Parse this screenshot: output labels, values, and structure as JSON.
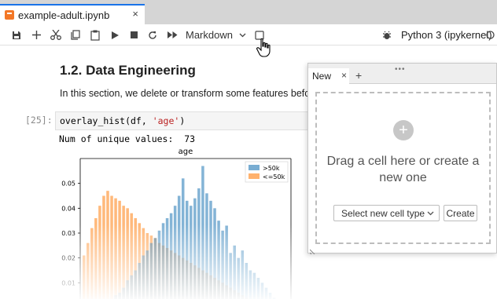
{
  "tab": {
    "title": "example-adult.ipynb",
    "close": "×"
  },
  "toolbar": {
    "cell_type": "Markdown",
    "kernel": "Python 3 (ipykernel)"
  },
  "notebook": {
    "heading": "1.2. Data Engineering",
    "paragraph": "In this section, we delete or transform some features before",
    "prompt": "[25]:",
    "code_fn": "overlay_hist(df, ",
    "code_str": "'age'",
    "code_end": ")",
    "output": "Num of unique values:  73"
  },
  "chart_data": {
    "type": "bar",
    "title": "age",
    "yticks": [
      "0.05",
      "0.04",
      "0.03",
      "0.02",
      "0.01"
    ],
    "ylim": [
      0,
      0.06
    ],
    "legend": [
      "<=50k",
      ">50k"
    ],
    "legend_position": "top-right",
    "series": [
      {
        "name": ">50k",
        "color": "#1f77b4",
        "values": [
          0.0,
          0.0,
          0.0,
          0.0,
          0.0,
          0.001,
          0.002,
          0.003,
          0.005,
          0.006,
          0.008,
          0.011,
          0.013,
          0.015,
          0.018,
          0.021,
          0.023,
          0.026,
          0.028,
          0.031,
          0.034,
          0.036,
          0.038,
          0.041,
          0.045,
          0.052,
          0.043,
          0.041,
          0.044,
          0.048,
          0.057,
          0.046,
          0.043,
          0.04,
          0.035,
          0.031,
          0.033,
          0.022,
          0.025,
          0.02,
          0.023,
          0.018,
          0.015,
          0.014,
          0.012,
          0.01,
          0.008,
          0.006,
          0.004,
          0.003,
          0.002,
          0.001
        ]
      },
      {
        "name": "<=50k",
        "color": "#ff7f0e",
        "values": [
          0.021,
          0.026,
          0.032,
          0.036,
          0.041,
          0.045,
          0.047,
          0.045,
          0.044,
          0.043,
          0.041,
          0.04,
          0.038,
          0.036,
          0.034,
          0.032,
          0.03,
          0.029,
          0.028,
          0.026,
          0.025,
          0.024,
          0.023,
          0.022,
          0.021,
          0.02,
          0.019,
          0.018,
          0.017,
          0.016,
          0.015,
          0.014,
          0.013,
          0.012,
          0.011,
          0.01,
          0.009,
          0.008,
          0.007,
          0.006,
          0.005,
          0.004,
          0.003,
          0.003,
          0.002,
          0.002,
          0.001,
          0.001,
          0.001,
          0.0,
          0.0,
          0.0
        ]
      }
    ]
  },
  "panel": {
    "tab_label": "New",
    "tab_close": "×",
    "tab_add": "+",
    "grip": "•••",
    "plus": "+",
    "drag_text": "Drag a cell here or create a new one",
    "select_label": "Select new cell type",
    "create_label": "Create"
  }
}
